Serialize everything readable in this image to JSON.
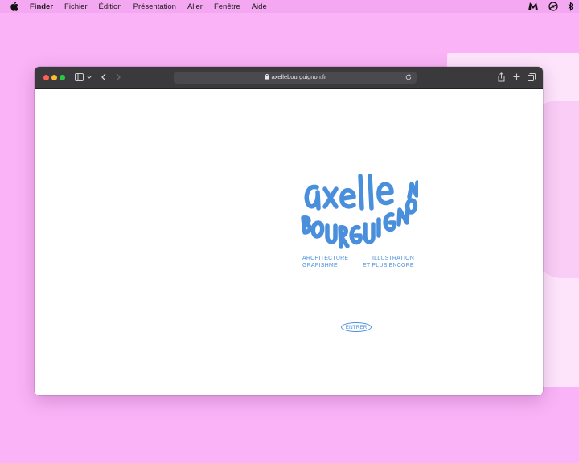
{
  "menubar": {
    "app": "Finder",
    "items": [
      "Fichier",
      "Édition",
      "Présentation",
      "Aller",
      "Fenêtre",
      "Aide"
    ]
  },
  "browser": {
    "url": "axellebourguignon.fr"
  },
  "page": {
    "logo_line1": "axelle",
    "logo_line2": "BOURGUIGNON",
    "tags": {
      "left_1": "ARCHITECTURE",
      "left_2": "GRAPISHME",
      "right_1": "ILLUSTRATION",
      "right_2": "ET PLUS ENCORE"
    },
    "enter_label": "ENTRER"
  },
  "colors": {
    "desktop": "#f9b3f6",
    "brand_blue": "#4a8fdc",
    "toolbar": "#3a393c"
  }
}
